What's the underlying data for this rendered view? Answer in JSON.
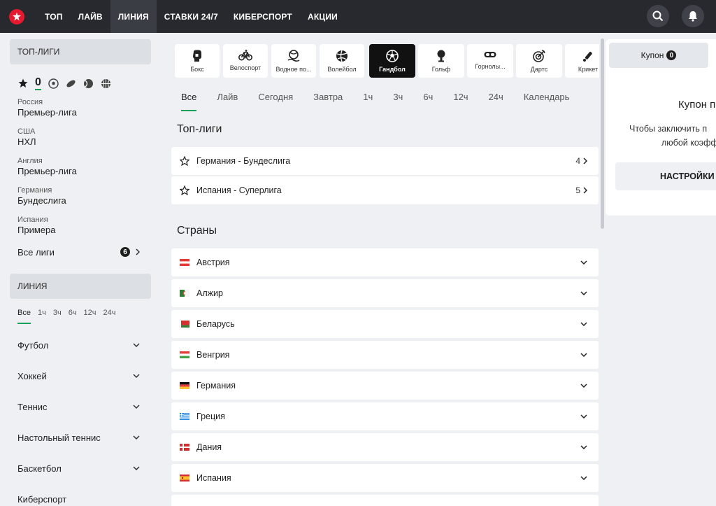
{
  "nav": {
    "items": [
      "ТОП",
      "ЛАЙВ",
      "ЛИНИЯ",
      "СТАВКИ 24/7",
      "КИБЕРСПОРТ",
      "АКЦИИ"
    ],
    "active": "ЛИНИЯ"
  },
  "sidebar": {
    "top_leagues_header": "ТОП-ЛИГИ",
    "zero_count": "0",
    "leagues": [
      {
        "country": "Россия",
        "name": "Премьер-лига"
      },
      {
        "country": "США",
        "name": "НХЛ"
      },
      {
        "country": "Англия",
        "name": "Премьер-лига"
      },
      {
        "country": "Германия",
        "name": "Бундеслига"
      },
      {
        "country": "Испания",
        "name": "Примера"
      }
    ],
    "all_leagues_label": "Все лиги",
    "all_leagues_count": "6",
    "line_header": "ЛИНИЯ",
    "time_tabs": [
      "Все",
      "1ч",
      "3ч",
      "6ч",
      "12ч",
      "24ч"
    ],
    "sports": [
      "Футбол",
      "Хоккей",
      "Теннис",
      "Настольный теннис",
      "Баскетбол",
      "Киберспорт"
    ]
  },
  "sports_strip": [
    {
      "label": "Бокс",
      "icon": "boxing-glove-icon"
    },
    {
      "label": "Велоспорт",
      "icon": "bicycle-icon"
    },
    {
      "label": "Водное по...",
      "icon": "water-polo-icon"
    },
    {
      "label": "Волейбол",
      "icon": "volleyball-icon"
    },
    {
      "label": "Гандбол",
      "icon": "handball-icon",
      "active": true
    },
    {
      "label": "Гольф",
      "icon": "golf-icon"
    },
    {
      "label": "Горнолы...",
      "icon": "ski-goggles-icon"
    },
    {
      "label": "Дартс",
      "icon": "dartboard-icon"
    },
    {
      "label": "Крикет",
      "icon": "cricket-bat-icon"
    }
  ],
  "filters": [
    "Все",
    "Лайв",
    "Сегодня",
    "Завтра",
    "1ч",
    "3ч",
    "6ч",
    "12ч",
    "24ч",
    "Календарь"
  ],
  "top_leagues": {
    "title": "Топ-лиги",
    "items": [
      {
        "name": "Германия - Бундеслига",
        "count": "4"
      },
      {
        "name": "Испания - Суперлига",
        "count": "5"
      }
    ]
  },
  "countries": {
    "title": "Страны",
    "items": [
      "Австрия",
      "Алжир",
      "Беларусь",
      "Венгрия",
      "Германия",
      "Греция",
      "Дания",
      "Испания"
    ]
  },
  "coupon": {
    "tab_label": "Купон",
    "tab_count": "0",
    "title": "Купон п",
    "text_line1": "Чтобы заключить п",
    "text_line2": "любой коэфф",
    "settings_label": "НАСТРОЙКИ"
  },
  "colors": {
    "accent_green": "#16a05a",
    "topbar": "#27292e",
    "logo_red": "#e51a2e"
  }
}
